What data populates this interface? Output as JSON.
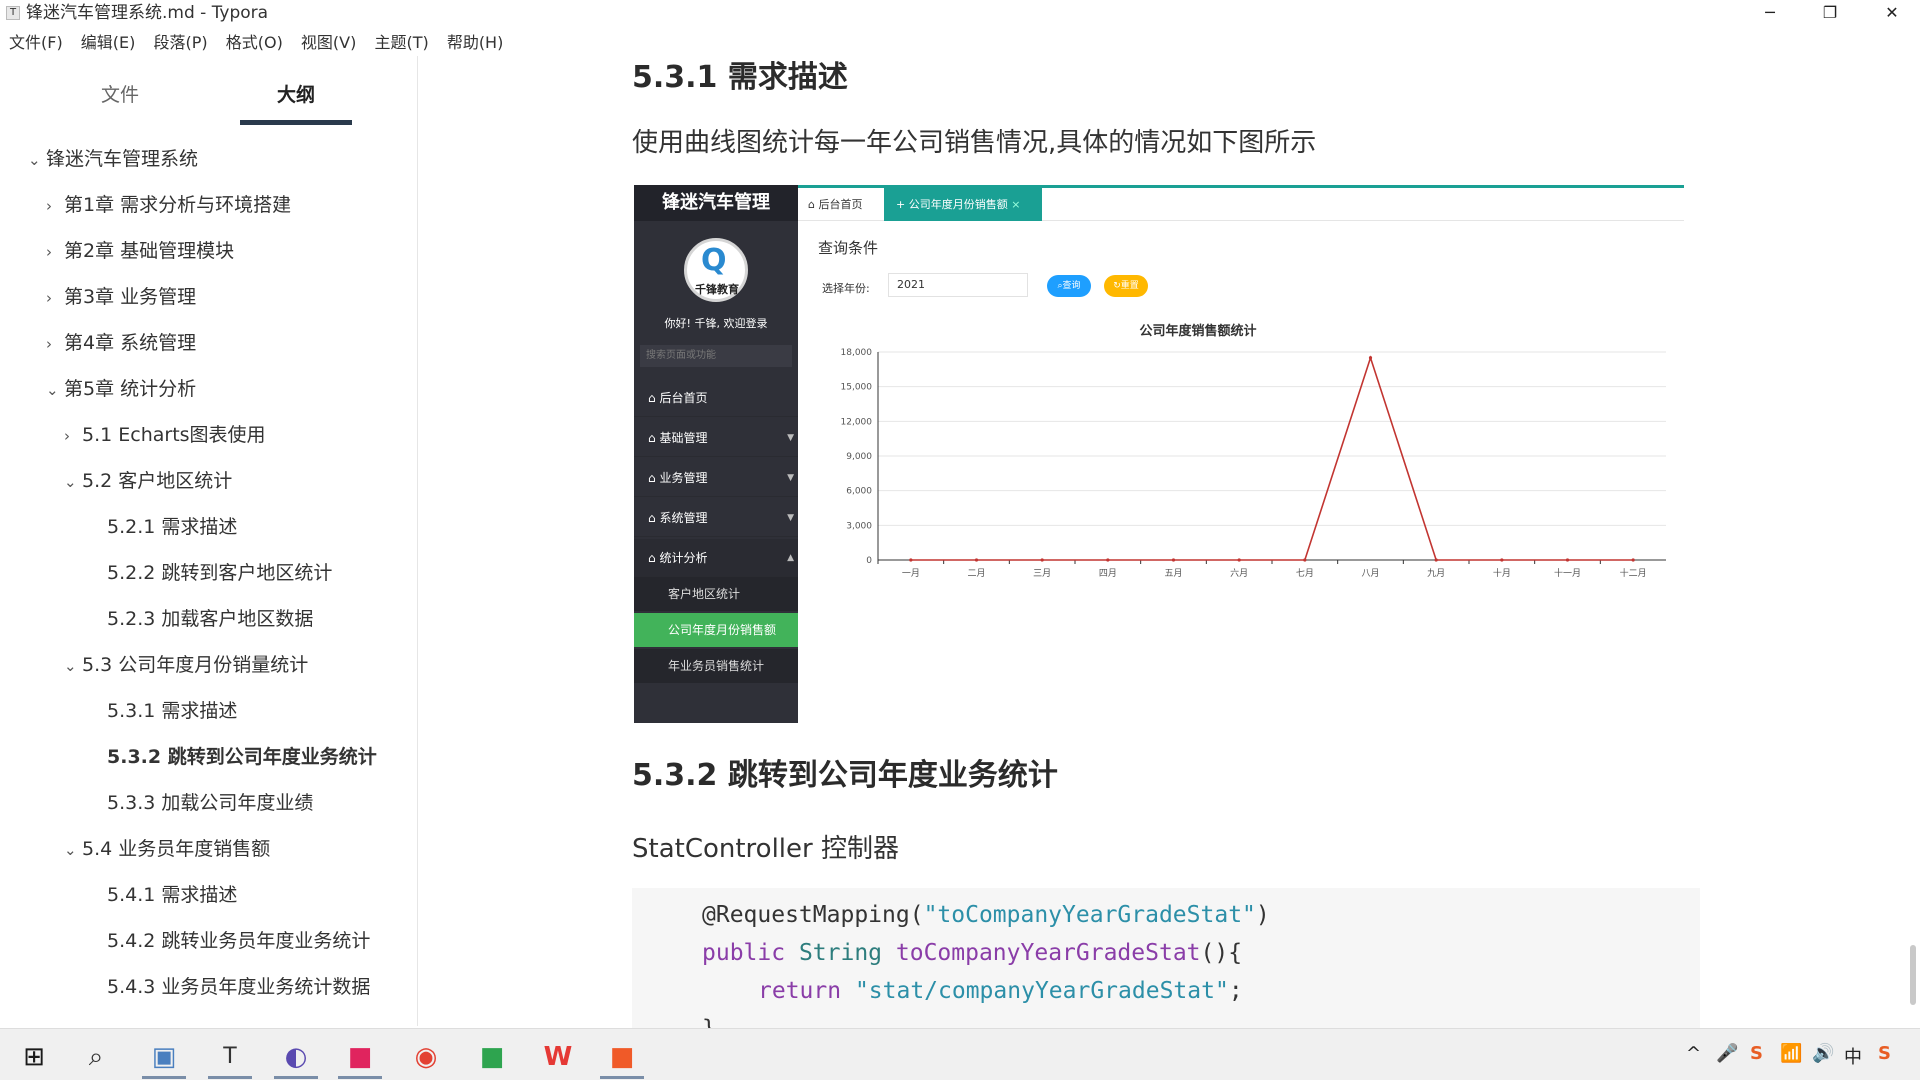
{
  "window": {
    "title": "锋迷汽车管理系统.md - Typora",
    "app_icon": "T",
    "minimize": "─",
    "restore": "❐",
    "close": "✕"
  },
  "menu": [
    "文件(F)",
    "编辑(E)",
    "段落(P)",
    "格式(O)",
    "视图(V)",
    "主题(T)",
    "帮助(H)"
  ],
  "sidebar": {
    "tabs": [
      "文件",
      "大纲"
    ],
    "active_tab": "大纲",
    "toc": [
      {
        "label": "锋迷汽车管理系统",
        "arrow": "⌄"
      },
      {
        "label": "第1章 需求分析与环境搭建",
        "arrow": "›"
      },
      {
        "label": "第2章 基础管理模块",
        "arrow": "›"
      },
      {
        "label": "第3章 业务管理",
        "arrow": "›"
      },
      {
        "label": "第4章 系统管理",
        "arrow": "›"
      },
      {
        "label": "第5章 统计分析",
        "arrow": "⌄"
      },
      {
        "label": "5.1 Echarts图表使用",
        "arrow": "›"
      },
      {
        "label": "5.2 客户地区统计",
        "arrow": "⌄"
      },
      {
        "label": "5.2.1 需求描述",
        "arrow": ""
      },
      {
        "label": "5.2.2 跳转到客户地区统计",
        "arrow": ""
      },
      {
        "label": "5.2.3 加载客户地区数据",
        "arrow": ""
      },
      {
        "label": "5.3 公司年度月份销量统计",
        "arrow": "⌄"
      },
      {
        "label": "5.3.1 需求描述",
        "arrow": ""
      },
      {
        "label": "5.3.2 跳转到公司年度业务统计",
        "arrow": ""
      },
      {
        "label": "5.3.3 加载公司年度业绩",
        "arrow": ""
      },
      {
        "label": "5.4 业务员年度销售额",
        "arrow": "⌄"
      },
      {
        "label": "5.4.1 需求描述",
        "arrow": ""
      },
      {
        "label": "5.4.2 跳转业务员年度业务统计",
        "arrow": ""
      },
      {
        "label": "5.4.3 业务员年度业务统计数据",
        "arrow": ""
      }
    ]
  },
  "doc": {
    "h_531": "5.3.1 需求描述",
    "p_531": "使用曲线图统计每一年公司销售情况,具体的情况如下图所示",
    "h_532": "5.3.2 跳转到公司年度业务统计",
    "p_532": "StatController 控制器",
    "code": {
      "l1a": "@RequestMapping(",
      "l1b": "\"toCompanyYearGradeStat\"",
      "l1c": ")",
      "l2a": "public ",
      "l2b": "String ",
      "l2c": "toCompanyYearGradeStat",
      "l2d": "(){",
      "l3a": "return ",
      "l3b": "\"stat/companyYearGradeStat\"",
      "l3c": ";",
      "l4": "}"
    }
  },
  "screenshot": {
    "brand": "锋迷汽车管理",
    "logo_text": "千锋教育",
    "greeting": "你好! 千锋, 欢迎登录",
    "search_placeholder": "搜索页面或功能",
    "nav": [
      "后台首页",
      "基础管理",
      "业务管理",
      "系统管理",
      "统计分析"
    ],
    "sub": [
      "客户地区统计",
      "公司年度月份销售额",
      "年业务员销售统计"
    ],
    "tabs": [
      "后台首页",
      "公司年度月份销售额"
    ],
    "query_title": "查询条件",
    "year_label": "选择年份:",
    "year_value": "2021",
    "btn_query": "查询",
    "btn_reset": "重置"
  },
  "chart_data": {
    "type": "line",
    "title": "公司年度销售额统计",
    "categories": [
      "一月",
      "二月",
      "三月",
      "四月",
      "五月",
      "六月",
      "七月",
      "八月",
      "九月",
      "十月",
      "十一月",
      "十二月"
    ],
    "series": [
      {
        "values": [
          0,
          0,
          0,
          0,
          0,
          0,
          0,
          17500,
          0,
          0,
          0,
          0
        ],
        "color": "#c23531"
      }
    ],
    "yticks": [
      "0",
      "3,000",
      "6,000",
      "9,000",
      "12,000",
      "15,000",
      "18,000"
    ],
    "ylim": [
      0,
      18000
    ],
    "grid": true
  },
  "taskbar": {
    "icons": [
      "windows-start",
      "search",
      "file-explorer",
      "typora",
      "eclipse",
      "intellij",
      "chrome",
      "pycharm",
      "wps",
      "jetbrains"
    ],
    "tray": [
      "^",
      "🎤",
      "S",
      "📶",
      "🔊",
      "中",
      "S"
    ]
  }
}
